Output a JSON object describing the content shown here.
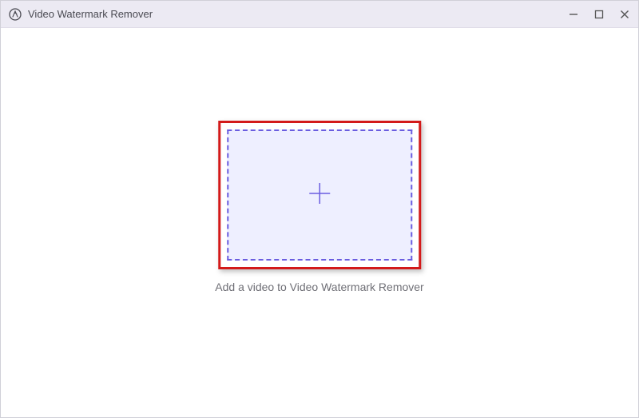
{
  "titlebar": {
    "app_title": "Video Watermark Remover",
    "icons": {
      "app": "app-logo-icon",
      "minimize": "minimize-icon",
      "maximize": "maximize-icon",
      "close": "close-icon"
    }
  },
  "main": {
    "dropzone": {
      "caption": "Add a video to Video Watermark Remover"
    }
  },
  "colors": {
    "titlebar_bg": "#eceaf3",
    "accent": "#6a5de0",
    "highlight_border": "#d31a1a",
    "dropzone_fill": "#eeefff"
  }
}
